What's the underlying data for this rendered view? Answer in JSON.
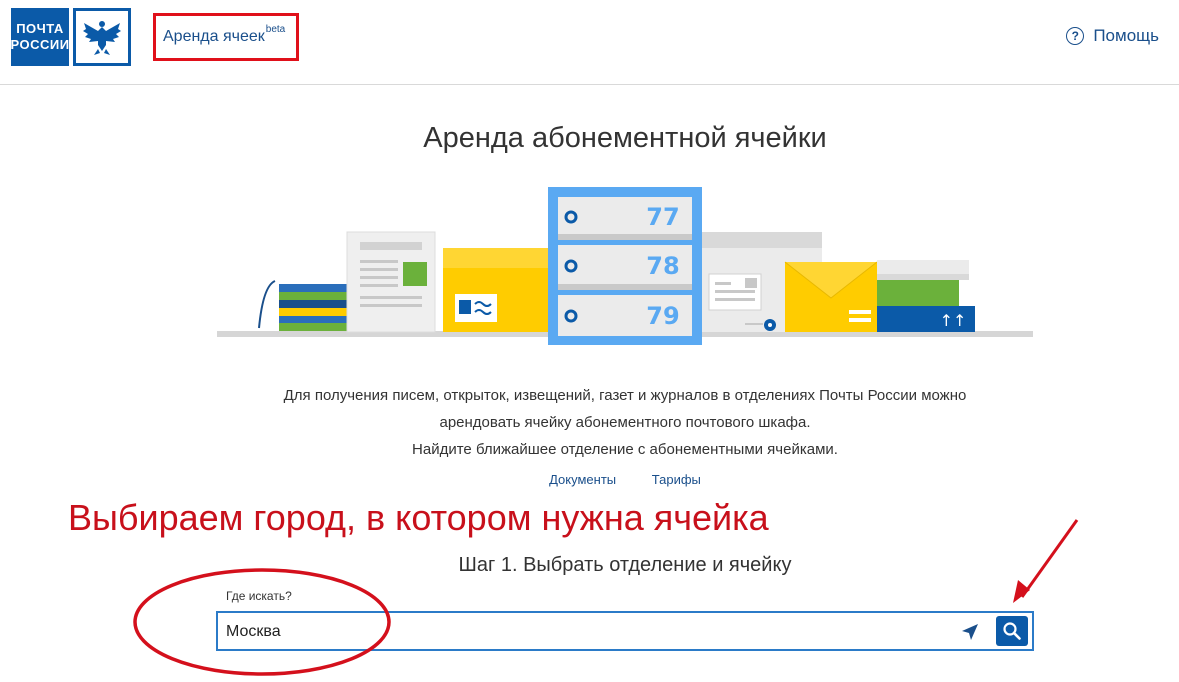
{
  "header": {
    "logo_line1": "ПОЧТА",
    "logo_line2": "РОССИИ",
    "service": "Аренда ячеек",
    "service_badge": "beta",
    "help": "Помощь"
  },
  "main": {
    "title": "Аренда абонементной ячейки",
    "boxes": [
      "77",
      "78",
      "79"
    ],
    "description_line1": "Для получения писем, открыток, извещений, газет и журналов в отделениях Почты России можно",
    "description_line2": "арендовать ячейку абонементного почтового шкафа.",
    "description_line3": "Найдите ближайшее отделение с абонементными ячейками.",
    "link_documents": "Документы",
    "link_tariffs": "Тарифы",
    "annotation": "Выбираем город, в котором нужна ячейка",
    "step": "Шаг 1. Выбрать отделение и ячейку",
    "search": {
      "label": "Где искать?",
      "value": "Москва"
    }
  },
  "colors": {
    "brand_blue": "#0b5aa8",
    "link_blue": "#1a4f8b",
    "annotation_red": "#c8101b",
    "box_frame": "#5aa9f2",
    "yellow": "#ffcc00",
    "green": "#6bb13b"
  }
}
